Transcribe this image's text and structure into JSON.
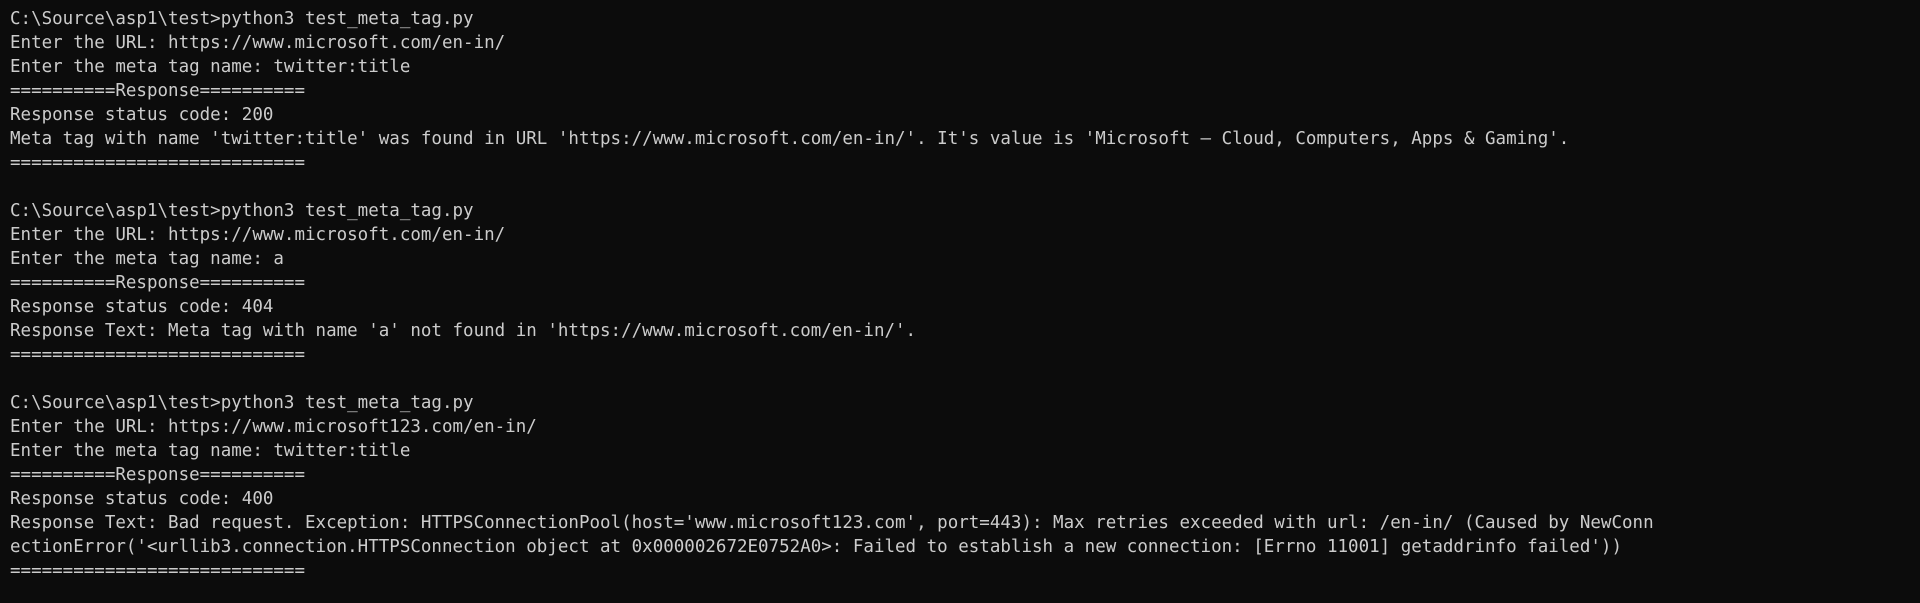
{
  "terminal": {
    "lines": [
      "C:\\Source\\asp1\\test>python3 test_meta_tag.py",
      "Enter the URL: https://www.microsoft.com/en-in/",
      "Enter the meta tag name: twitter:title",
      "==========Response==========",
      "Response status code: 200",
      "Meta tag with name 'twitter:title' was found in URL 'https://www.microsoft.com/en-in/'. It's value is 'Microsoft – Cloud, Computers, Apps & Gaming'.",
      "============================",
      "",
      "C:\\Source\\asp1\\test>python3 test_meta_tag.py",
      "Enter the URL: https://www.microsoft.com/en-in/",
      "Enter the meta tag name: a",
      "==========Response==========",
      "Response status code: 404",
      "Response Text: Meta tag with name 'a' not found in 'https://www.microsoft.com/en-in/'.",
      "============================",
      "",
      "C:\\Source\\asp1\\test>python3 test_meta_tag.py",
      "Enter the URL: https://www.microsoft123.com/en-in/",
      "Enter the meta tag name: twitter:title",
      "==========Response==========",
      "Response status code: 400",
      "Response Text: Bad request. Exception: HTTPSConnectionPool(host='www.microsoft123.com', port=443): Max retries exceeded with url: /en-in/ (Caused by NewConn",
      "ectionError('<urllib3.connection.HTTPSConnection object at 0x000002672E0752A0>: Failed to establish a new connection: [Errno 11001] getaddrinfo failed'))",
      "============================"
    ]
  },
  "colors": {
    "background": "#0c0c0c",
    "foreground": "#cccccc"
  }
}
